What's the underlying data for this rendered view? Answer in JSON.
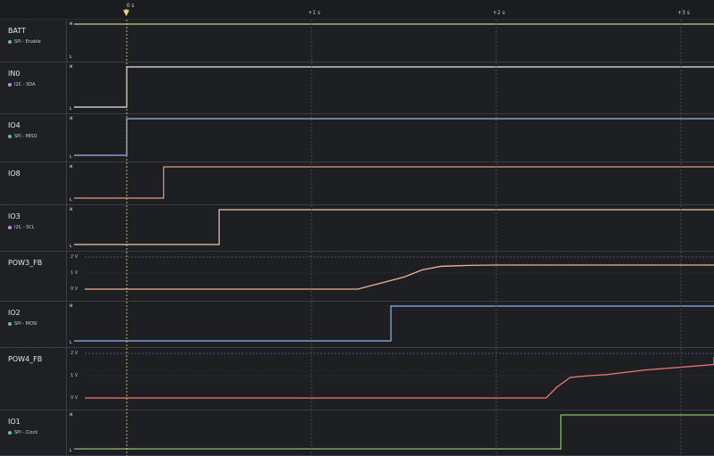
{
  "timeline": {
    "labels": [
      "0 s",
      "+1 s",
      "+2 s",
      "+3 s"
    ],
    "trigger_letter": "T",
    "cursor_color": "#f5dc5a"
  },
  "channels": [
    {
      "name": "BATT",
      "protocol": "SPI - Enable",
      "dot": "#58c4b6",
      "type": "digital",
      "color": "#c7d07a",
      "initial": 1,
      "transitions": []
    },
    {
      "name": "IN0",
      "protocol": "I2C - SDA",
      "dot": "#c986f0",
      "type": "digital",
      "color": "#e8e8e8",
      "initial": 0,
      "transitions": [
        0
      ]
    },
    {
      "name": "IO4",
      "protocol": "SPI - MISO",
      "dot": "#58c4b6",
      "type": "digital",
      "color": "#9ab6ee",
      "initial": 0,
      "transitions": [
        0
      ]
    },
    {
      "name": "IO8",
      "protocol": "",
      "dot": "",
      "type": "digital",
      "color": "#e9977d",
      "initial": 0,
      "transitions": [
        0.2
      ]
    },
    {
      "name": "IO3",
      "protocol": "I2C - SCL",
      "dot": "#c986f0",
      "type": "digital",
      "color": "#f0c9a6",
      "initial": 0,
      "transitions": [
        0.5
      ]
    },
    {
      "name": "POW3_FB",
      "protocol": "",
      "dot": "",
      "type": "analog",
      "color": "#f0b393",
      "volt_labels": [
        "2 V",
        "1 V",
        "0 V"
      ],
      "curve": [
        [
          -0.66,
          0
        ],
        [
          1.25,
          0
        ],
        [
          1.35,
          0.3
        ],
        [
          1.5,
          0.75
        ],
        [
          1.6,
          1.2
        ],
        [
          1.7,
          1.42
        ],
        [
          1.85,
          1.48
        ],
        [
          2.0,
          1.5
        ],
        [
          3.5,
          1.5
        ]
      ]
    },
    {
      "name": "IO2",
      "protocol": "SPI - MOSI",
      "dot": "#58c4b6",
      "type": "digital",
      "color": "#88b4ee",
      "initial": 0,
      "transitions": [
        1.43
      ]
    },
    {
      "name": "POW4_FB",
      "protocol": "",
      "dot": "",
      "type": "analog",
      "color": "#f07878",
      "volt_labels": [
        "2 V",
        "1 V",
        "0 V"
      ],
      "curve": [
        [
          -0.66,
          0
        ],
        [
          2.27,
          0
        ],
        [
          2.33,
          0.5
        ],
        [
          2.4,
          0.92
        ],
        [
          2.5,
          1.0
        ],
        [
          2.6,
          1.05
        ],
        [
          2.8,
          1.25
        ],
        [
          3.0,
          1.38
        ],
        [
          3.2,
          1.5
        ],
        [
          3.4,
          1.68
        ],
        [
          3.46,
          1.84
        ],
        [
          3.6,
          1.84
        ]
      ]
    },
    {
      "name": "IO1",
      "protocol": "SPI - Clock",
      "dot": "#58c4b6",
      "type": "digital",
      "color": "#8ec46a",
      "initial": 0,
      "transitions": [
        2.35
      ]
    }
  ],
  "level_labels": {
    "high": "H",
    "low": "L"
  }
}
